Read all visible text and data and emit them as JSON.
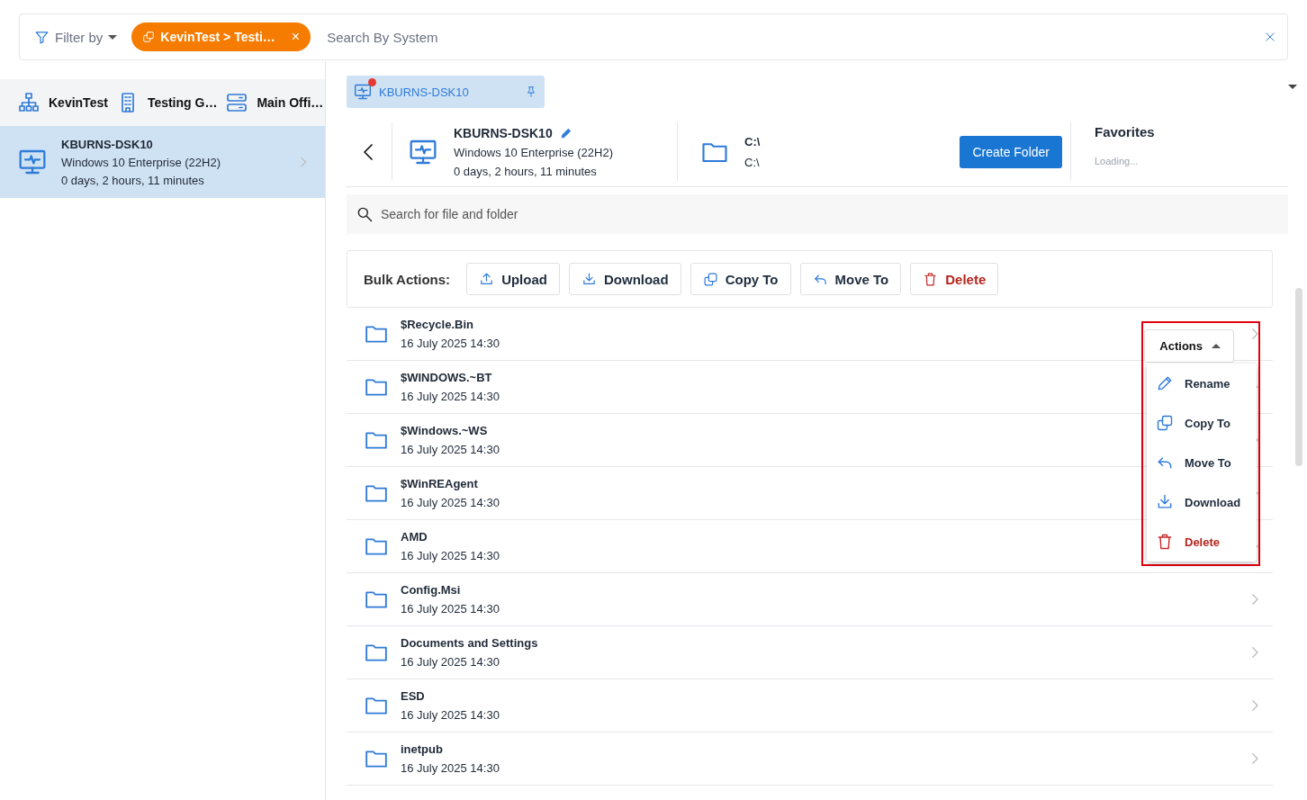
{
  "filter_bar": {
    "filter_label": "Filter by",
    "chip": {
      "label": "KevinTest > Testi…",
      "close": "×"
    },
    "search": {
      "placeholder": "Search By System"
    }
  },
  "breadcrumb": [
    {
      "kind": "org",
      "label": "KevinTest"
    },
    {
      "kind": "site",
      "label": "Testing G…"
    },
    {
      "kind": "server",
      "label": "Main Offi…"
    }
  ],
  "systems": [
    {
      "name": "KBURNS-DSK10",
      "os": "Windows 10 Enterprise (22H2)",
      "uptime": "0 days, 2 hours, 11 minutes",
      "selected": true
    }
  ],
  "open_tab": {
    "label": "KBURNS-DSK10",
    "alert": true
  },
  "device": {
    "name": "KBURNS-DSK10",
    "os": "Windows 10 Enterprise (22H2)",
    "uptime": "0 days, 2 hours, 11 minutes"
  },
  "path": {
    "title": "C:\\",
    "subtitle": "C:\\"
  },
  "create_button": "Create Folder",
  "favorites": {
    "title": "Favorites",
    "status": "Loading..."
  },
  "file_search": {
    "placeholder": "Search for file and folder"
  },
  "bulk_actions": {
    "label": "Bulk Actions:",
    "buttons": [
      {
        "kind": "upload",
        "label": "Upload"
      },
      {
        "kind": "download",
        "label": "Download"
      },
      {
        "kind": "copy",
        "label": "Copy To"
      },
      {
        "kind": "move",
        "label": "Move To"
      },
      {
        "kind": "delete",
        "label": "Delete"
      }
    ]
  },
  "rows": [
    {
      "name": "$Recycle.Bin",
      "date": "16 July 2025 14:30"
    },
    {
      "name": "$WINDOWS.~BT",
      "date": "16 July 2025 14:30"
    },
    {
      "name": "$Windows.~WS",
      "date": "16 July 2025 14:30"
    },
    {
      "name": "$WinREAgent",
      "date": "16 July 2025 14:30"
    },
    {
      "name": "AMD",
      "date": "16 July 2025 14:30"
    },
    {
      "name": "Config.Msi",
      "date": "16 July 2025 14:30"
    },
    {
      "name": "Documents and Settings",
      "date": "16 July 2025 14:30"
    },
    {
      "name": "ESD",
      "date": "16 July 2025 14:30"
    },
    {
      "name": "inetpub",
      "date": "16 July 2025 14:30"
    }
  ],
  "actions_menu": {
    "label": "Actions",
    "items": [
      {
        "kind": "rename",
        "label": "Rename"
      },
      {
        "kind": "copy",
        "label": "Copy To"
      },
      {
        "kind": "move",
        "label": "Move To"
      },
      {
        "kind": "download",
        "label": "Download"
      },
      {
        "kind": "delete",
        "label": "Delete"
      }
    ]
  }
}
